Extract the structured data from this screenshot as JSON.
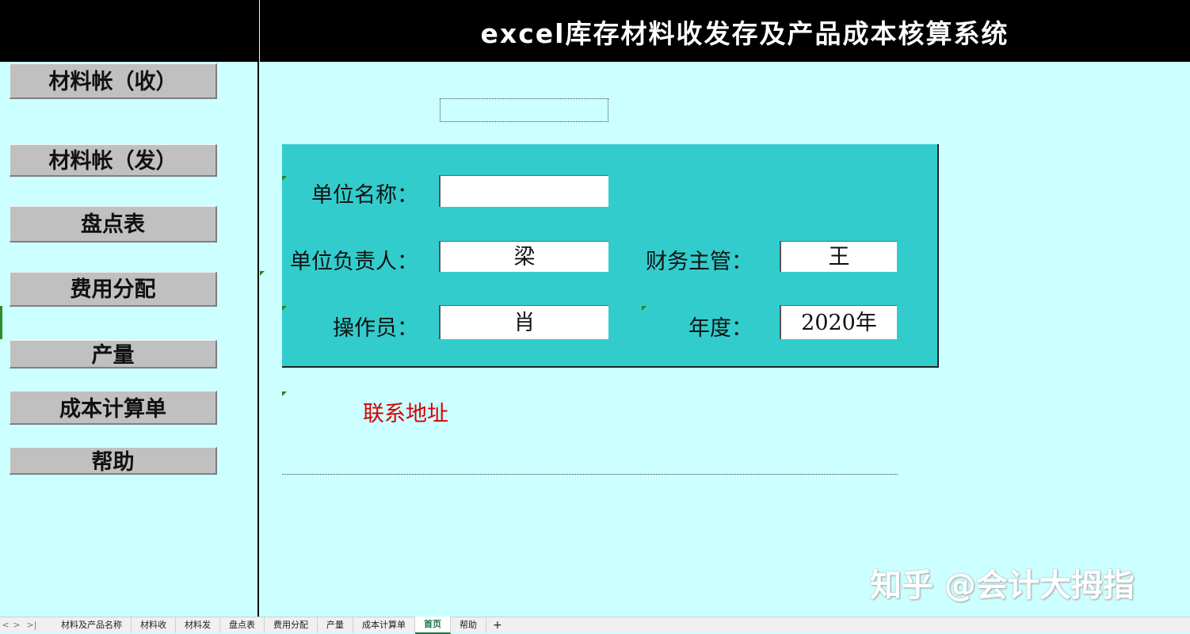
{
  "header": {
    "title": "excel库存材料收发存及产品成本核算系统"
  },
  "sidebar": {
    "buttons": [
      {
        "label": "材料帐（收）"
      },
      {
        "label": "材料帐（发）"
      },
      {
        "label": "盘点表"
      },
      {
        "label": "费用分配"
      },
      {
        "label": "产量"
      },
      {
        "label": "成本计算单"
      },
      {
        "label": "帮助"
      }
    ]
  },
  "form": {
    "unit_name_label": "单位名称：",
    "unit_name_value": "",
    "unit_head_label": "单位负责人：",
    "unit_head_value": "梁",
    "finance_head_label": "财务主管：",
    "finance_head_value": "王",
    "operator_label": "操作员：",
    "operator_value": "肖",
    "year_label": "年度：",
    "year_value": "2020年"
  },
  "contact": {
    "label": "联系地址"
  },
  "watermark": {
    "text": "知乎 @会计大拇指"
  },
  "sheet_tabs": {
    "nav": [
      "<",
      ">",
      ">|"
    ],
    "tabs": [
      {
        "label": "材料及产品名称"
      },
      {
        "label": "材料收"
      },
      {
        "label": "材料发"
      },
      {
        "label": "盘点表"
      },
      {
        "label": "费用分配"
      },
      {
        "label": "产量"
      },
      {
        "label": "成本计算单"
      },
      {
        "label": "首页"
      },
      {
        "label": "帮助"
      }
    ],
    "active_index": 7,
    "add": "+"
  }
}
